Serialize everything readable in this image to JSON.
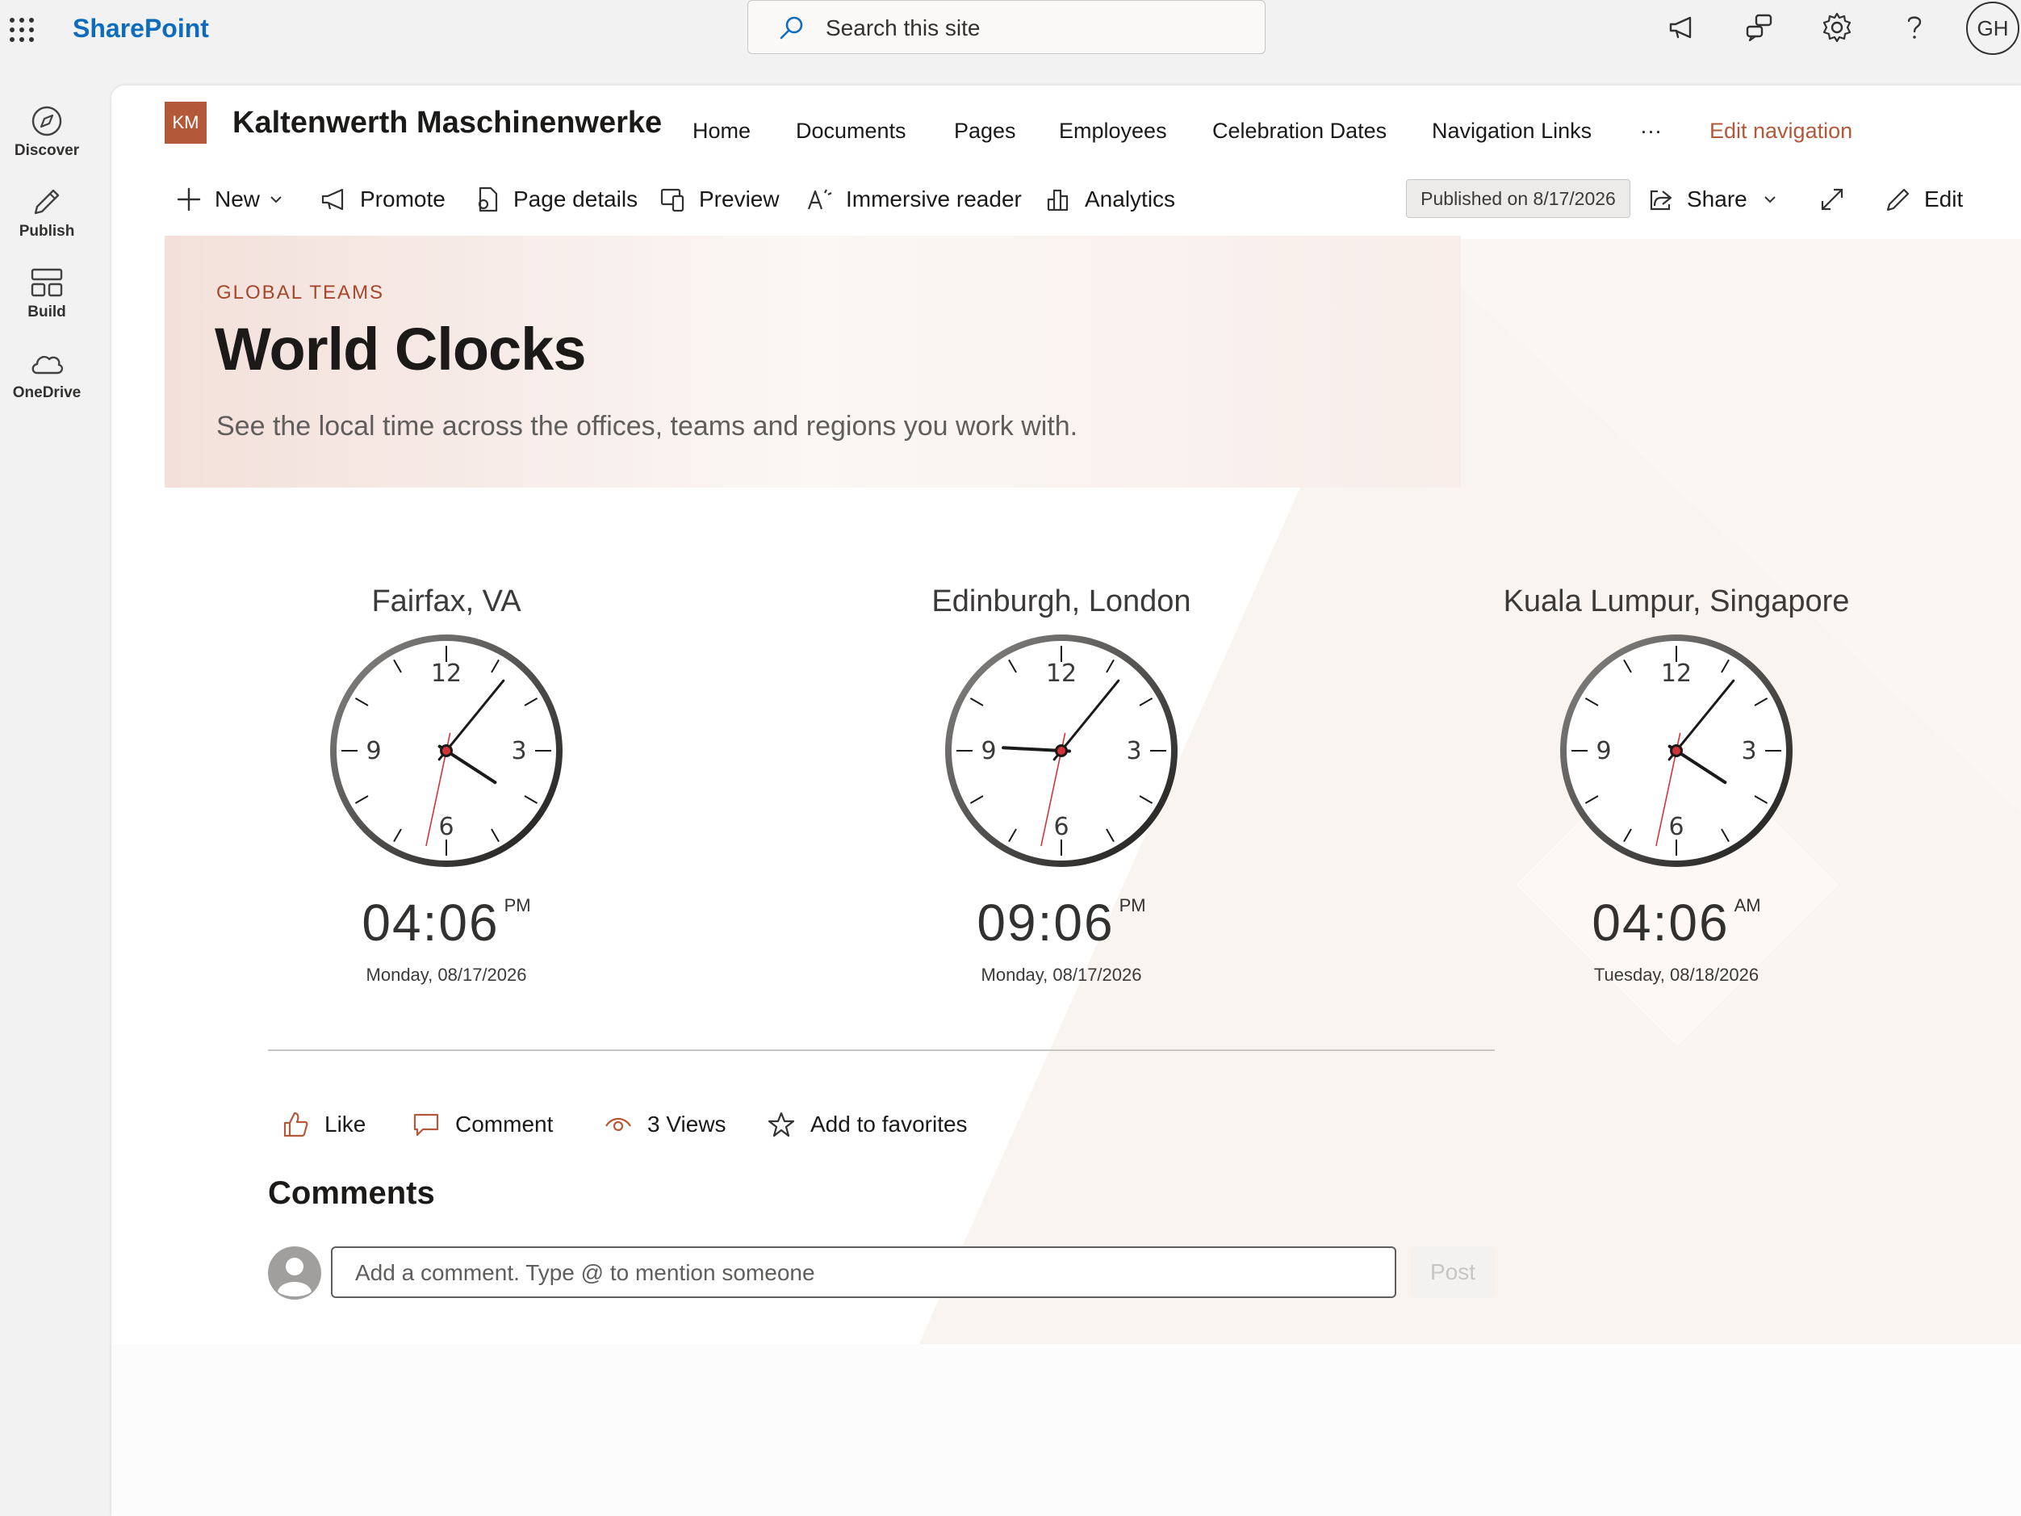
{
  "suite": {
    "brand": "SharePoint",
    "search_placeholder": "Search this site",
    "user_initials": "GH"
  },
  "appbar": {
    "items": [
      {
        "label": "Discover",
        "icon": "compass-icon"
      },
      {
        "label": "Publish",
        "icon": "pen-icon"
      },
      {
        "label": "Build",
        "icon": "layout-icon"
      },
      {
        "label": "OneDrive",
        "icon": "cloud-icon"
      }
    ]
  },
  "site": {
    "logo_initials": "KM",
    "title": "Kaltenwerth Maschinenwerke",
    "nav": [
      "Home",
      "Documents",
      "Pages",
      "Employees",
      "Celebration Dates",
      "Navigation Links"
    ],
    "nav_more": "···",
    "edit_nav": "Edit navigation"
  },
  "commands": {
    "new": "New",
    "promote": "Promote",
    "page_details": "Page details",
    "preview": "Preview",
    "immersive_reader": "Immersive reader",
    "analytics": "Analytics",
    "published": "Published on 8/17/2026",
    "share": "Share",
    "edit": "Edit"
  },
  "banner": {
    "eyebrow": "GLOBAL TEAMS",
    "title": "World Clocks",
    "subtitle": "See the local time across the offices, teams and regions you work with."
  },
  "clocks": [
    {
      "city": "Fairfax, VA",
      "time": "04:06",
      "ampm": "PM",
      "date": "Monday, 08/17/2026",
      "hour": 4,
      "minute": 6,
      "second": 32
    },
    {
      "city": "Edinburgh, London",
      "time": "09:06",
      "ampm": "PM",
      "date": "Monday, 08/17/2026",
      "hour": 9,
      "minute": 6,
      "second": 32
    },
    {
      "city": "Kuala Lumpur, Singapore",
      "time": "04:06",
      "ampm": "AM",
      "date": "Tuesday, 08/18/2026",
      "hour": 4,
      "minute": 6,
      "second": 32
    }
  ],
  "dial_numbers": [
    "12",
    "3",
    "6",
    "9"
  ],
  "social": {
    "like": "Like",
    "comment": "Comment",
    "views": "3 Views",
    "favorites": "Add to favorites"
  },
  "comments": {
    "title": "Comments",
    "placeholder": "Add a comment. Type @ to mention someone",
    "post": "Post"
  },
  "colors": {
    "accent": "#b4583a",
    "brand_blue": "#0f6cbd"
  }
}
